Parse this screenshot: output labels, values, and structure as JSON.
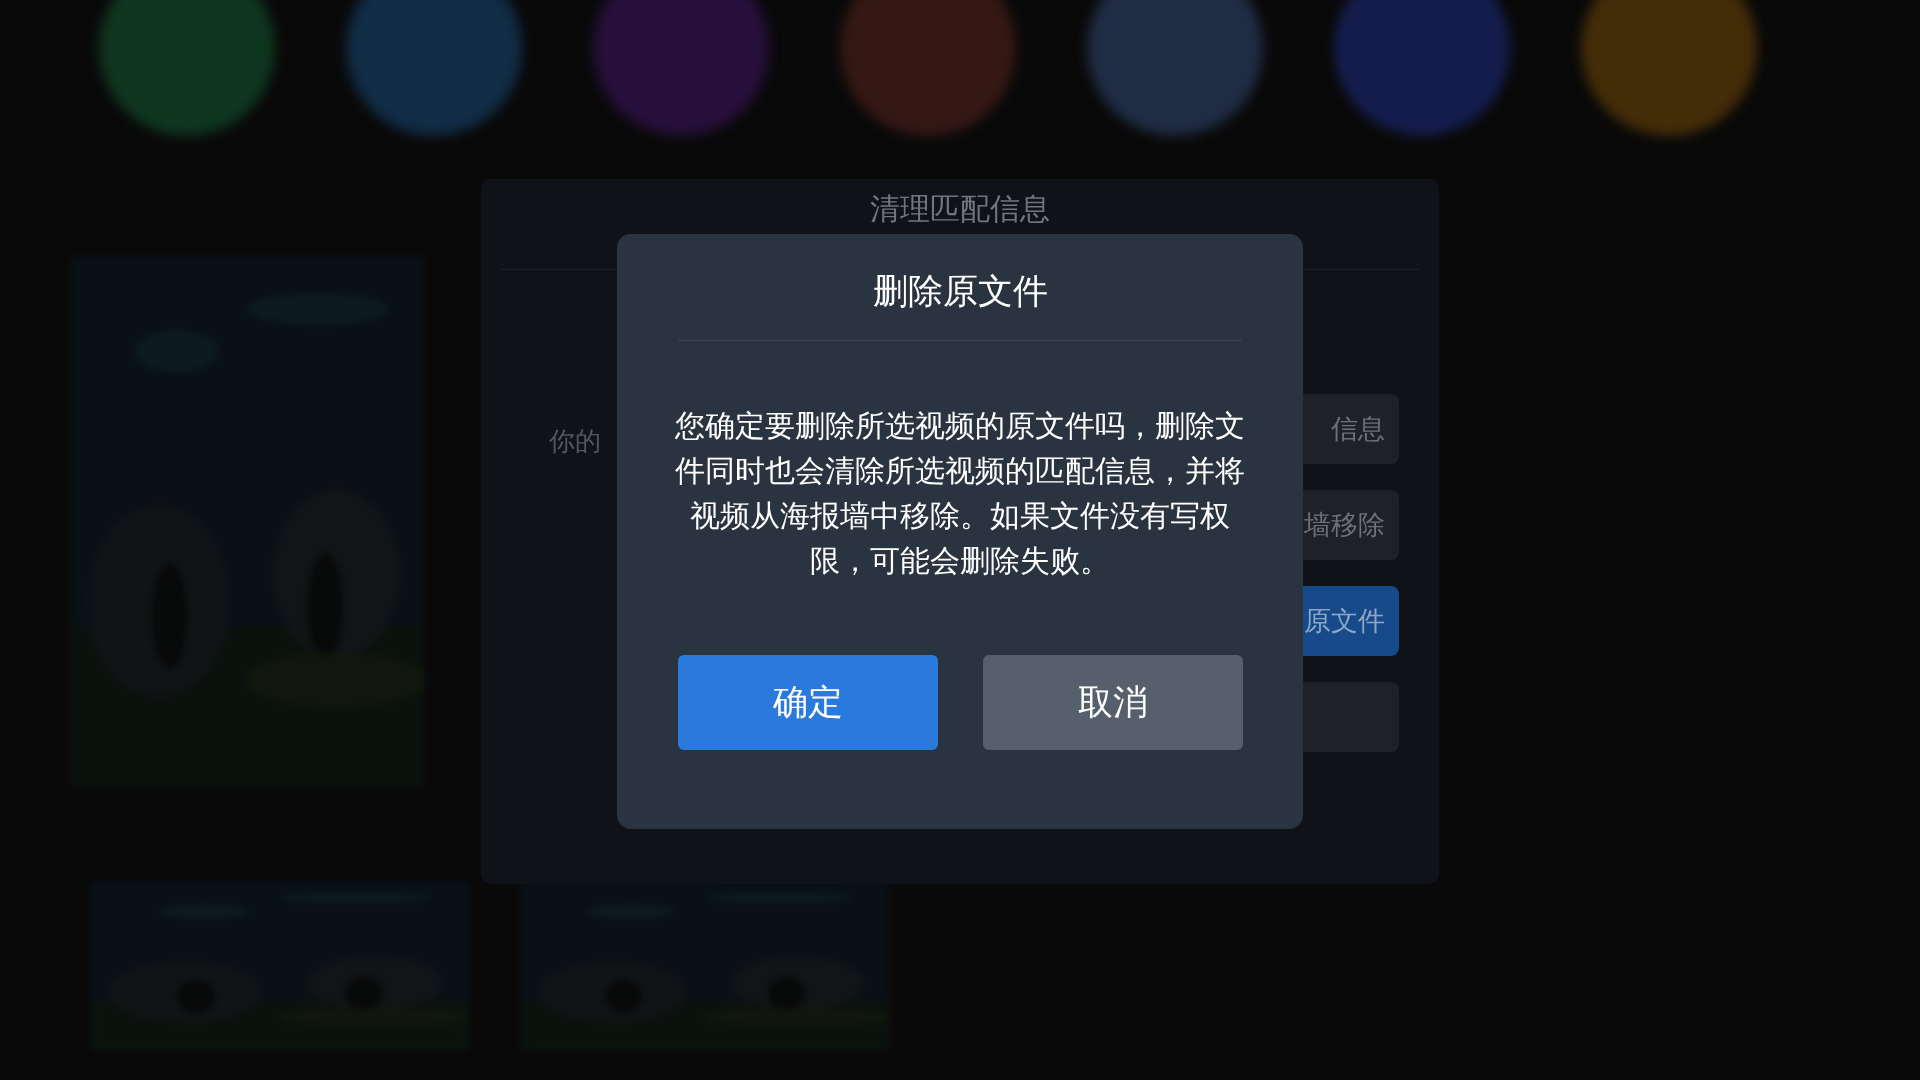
{
  "background": {
    "app_icons": [
      {
        "color": "#0f3b22"
      },
      {
        "color": "#12304c"
      },
      {
        "color": "#2a1040"
      },
      {
        "color": "#3a1a16"
      },
      {
        "color": "#22304a"
      },
      {
        "color": "#161f55"
      },
      {
        "color": "#4a3008"
      }
    ]
  },
  "panel": {
    "title": "清理匹配信息",
    "field_text": "你的",
    "options": [
      {
        "label": "信息",
        "selected": false
      },
      {
        "label": "墙移除",
        "selected": false
      },
      {
        "label": "原文件",
        "selected": true
      },
      {
        "selected": false
      }
    ]
  },
  "dialog": {
    "title": "删除原文件",
    "message": "您确定要删除所选视频的原文件吗，删除文件同时也会清除所选视频的匹配信息，并将视频从海报墙中移除。如果文件没有写权限，可能会删除失败。",
    "buttons": [
      {
        "label": "确定",
        "selected": true
      },
      {
        "label": "取消",
        "selected": false
      }
    ]
  }
}
